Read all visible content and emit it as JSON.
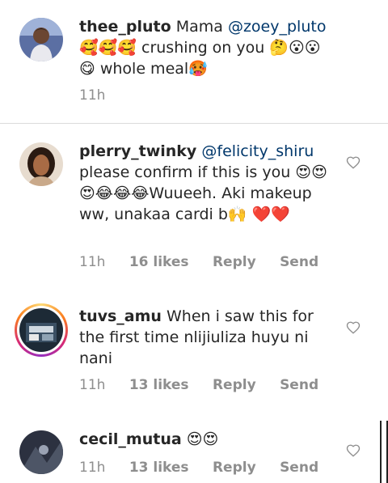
{
  "colors": {
    "text": "#262626",
    "secondary": "#8e8e8e",
    "mention": "#00376b",
    "divider": "#dbdbdb"
  },
  "comments": [
    {
      "username": "thee_pluto",
      "text_before": " Mama ",
      "mention": "@zoey_pluto",
      "text_after": " 🥰🥰🥰 crushing on you 🤔😮😮 😋 whole meal🥵",
      "time": "11h",
      "likes": "",
      "reply": "",
      "send": "",
      "avatar": "avatar-man-icon",
      "like_icon": "heart-outline-icon"
    },
    {
      "username": "plerry_twinky",
      "text_before": " ",
      "mention": "@felicity_shiru",
      "text_after": " please confirm if this is you 😍😍😍😂😂😂Wuueeh. Aki makeup ww, unakaa cardi b🙌 ❤️❤️",
      "time": "11h",
      "likes": "16 likes",
      "reply": "Reply",
      "send": "Send",
      "avatar": "avatar-woman-icon",
      "like_icon": "heart-outline-icon"
    },
    {
      "username": "tuvs_amu",
      "text_before": " When i saw this for the first time nlijiuliza huyu ni nani",
      "mention": "",
      "text_after": "",
      "time": "11h",
      "likes": "13 likes",
      "reply": "Reply",
      "send": "Send",
      "avatar": "avatar-store-icon",
      "like_icon": "heart-outline-icon"
    },
    {
      "username": "cecil_mutua",
      "text_before": " 😍😍",
      "mention": "",
      "text_after": "",
      "time": "11h",
      "likes": "13 likes",
      "reply": "Reply",
      "send": "Send",
      "avatar": "avatar-dark-icon",
      "like_icon": "heart-outline-icon"
    }
  ]
}
